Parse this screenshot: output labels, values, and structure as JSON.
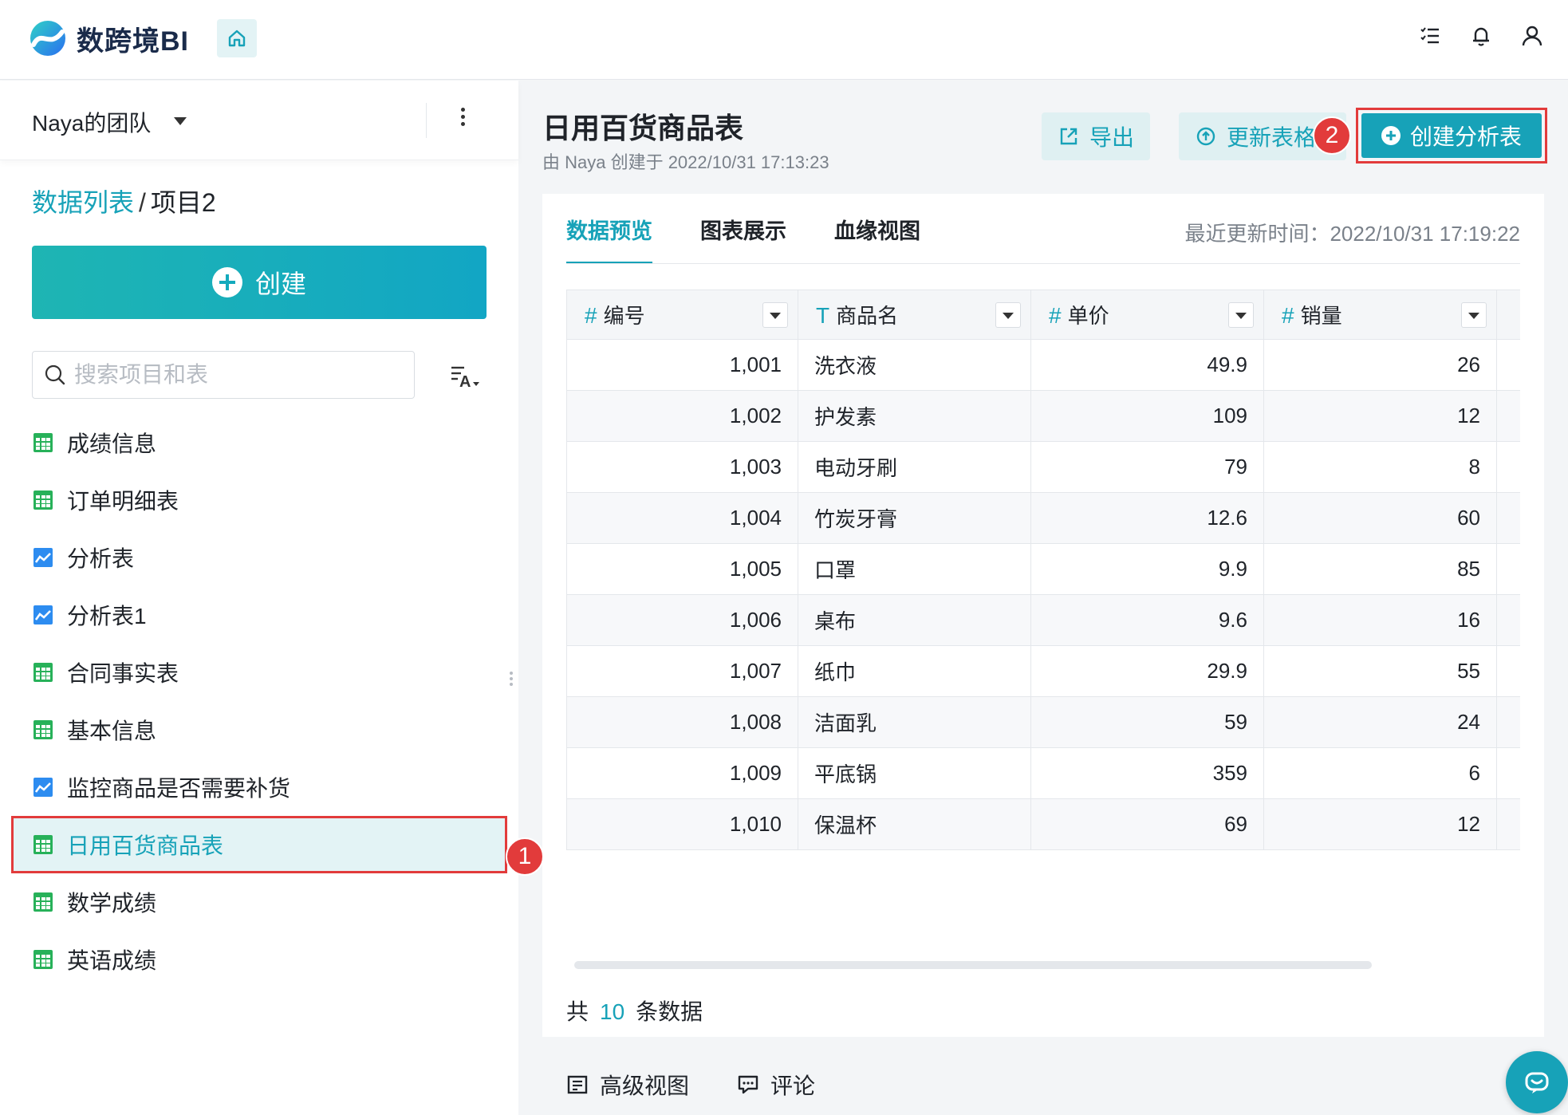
{
  "app": {
    "brand": "数跨境BI",
    "accent_color": "#17a2b8",
    "highlight_color": "#e23b3b"
  },
  "top_icons": [
    "task-list-icon",
    "bell-icon",
    "user-icon"
  ],
  "sidebar": {
    "team": "Naya的团队",
    "breadcrumb": {
      "root": "数据列表",
      "sep": "/",
      "current": "项目2"
    },
    "create_label": "创建",
    "search_placeholder": "搜索项目和表",
    "items": [
      {
        "label": "成绩信息",
        "icon": "table-icon"
      },
      {
        "label": "订单明细表",
        "icon": "table-icon"
      },
      {
        "label": "分析表",
        "icon": "analysis-icon"
      },
      {
        "label": "分析表1",
        "icon": "analysis-icon"
      },
      {
        "label": "合同事实表",
        "icon": "table-icon"
      },
      {
        "label": "基本信息",
        "icon": "table-icon"
      },
      {
        "label": "监控商品是否需要补货",
        "icon": "analysis-icon"
      },
      {
        "label": "日用百货商品表",
        "icon": "table-icon",
        "active": true
      },
      {
        "label": "数学成绩",
        "icon": "table-icon"
      },
      {
        "label": "英语成绩",
        "icon": "table-icon"
      }
    ],
    "step_badge": "1"
  },
  "main": {
    "title": "日用百货商品表",
    "subtitle": "由 Naya 创建于 2022/10/31 17:13:23",
    "export_label": "导出",
    "update_label": "更新表格",
    "create_analysis_label": "创建分析表",
    "step_badge": "2",
    "tabs": [
      "数据预览",
      "图表展示",
      "血缘视图"
    ],
    "updated_label": "最近更新时间：2022/10/31 17:19:22",
    "columns": [
      {
        "type": "#",
        "name": "编号"
      },
      {
        "type": "T",
        "name": "商品名"
      },
      {
        "type": "#",
        "name": "单价"
      },
      {
        "type": "#",
        "name": "销量"
      }
    ],
    "rows": [
      [
        "1,001",
        "洗衣液",
        "49.9",
        "26"
      ],
      [
        "1,002",
        "护发素",
        "109",
        "12"
      ],
      [
        "1,003",
        "电动牙刷",
        "79",
        "8"
      ],
      [
        "1,004",
        "竹炭牙膏",
        "12.6",
        "60"
      ],
      [
        "1,005",
        "口罩",
        "9.9",
        "85"
      ],
      [
        "1,006",
        "桌布",
        "9.6",
        "16"
      ],
      [
        "1,007",
        "纸巾",
        "29.9",
        "55"
      ],
      [
        "1,008",
        "洁面乳",
        "59",
        "24"
      ],
      [
        "1,009",
        "平底锅",
        "359",
        "6"
      ],
      [
        "1,010",
        "保温杯",
        "69",
        "12"
      ]
    ],
    "total": {
      "prefix": "共",
      "count": "10",
      "suffix": "条数据"
    },
    "footer": {
      "advanced_view": "高级视图",
      "comments": "评论"
    }
  }
}
